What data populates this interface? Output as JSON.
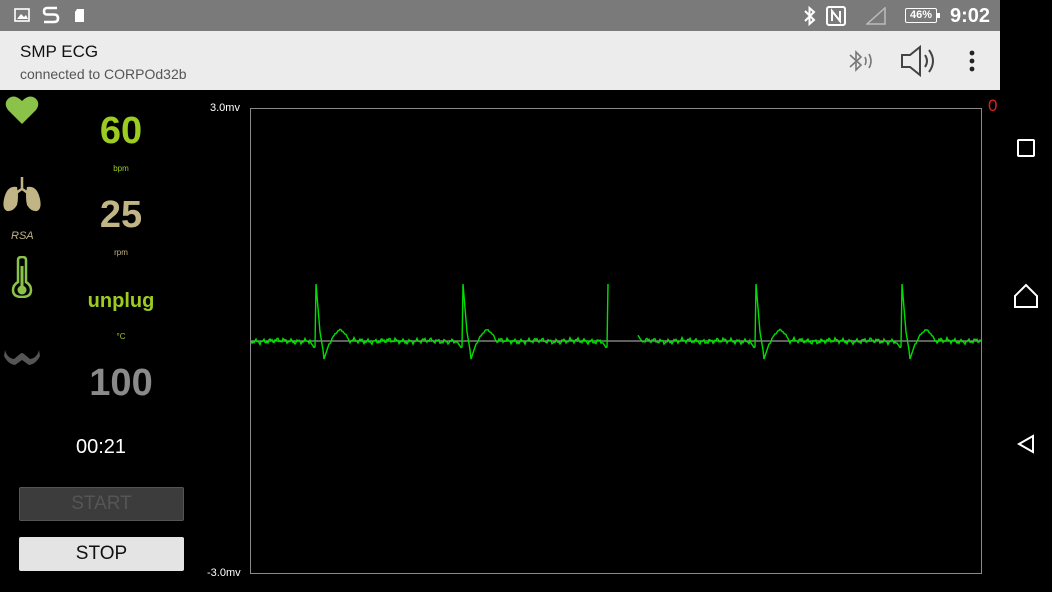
{
  "status_bar": {
    "time": "9:02",
    "battery": "46%",
    "left_icons": [
      "image-icon",
      "app-s-icon",
      "sim-icon"
    ],
    "right_icons": [
      "bluetooth-icon",
      "nfc-icon",
      "signal-icon"
    ]
  },
  "app_bar": {
    "title": "SMP ECG",
    "subtitle": "connected to CORPOd32b",
    "actions": [
      "bluetooth-audio-icon",
      "volume-icon",
      "overflow-menu-icon"
    ]
  },
  "vitals": {
    "heart_rate": {
      "value": "60",
      "unit": "bpm",
      "color": "#9ccc20"
    },
    "resp_rate": {
      "value": "25",
      "unit": "rpm",
      "label": "RSA",
      "color": "#c2b585"
    },
    "temperature": {
      "value": "unplug",
      "unit": "°C",
      "color": "#9ccc20"
    },
    "spo2": {
      "value": "100",
      "color": "#8a8a8a"
    }
  },
  "timer": "00:21",
  "buttons": {
    "start": "START",
    "stop": "STOP"
  },
  "ecg": {
    "y_max_label": "3.0mv",
    "y_min_label": "-3.0mv",
    "counter": "0",
    "trace_color": "#00e000"
  },
  "colors": {
    "accent_green": "#9ccc20",
    "counter_red": "#e02020",
    "appbar_bg": "#ececec",
    "statusbar_bg": "#7a7a7a"
  }
}
